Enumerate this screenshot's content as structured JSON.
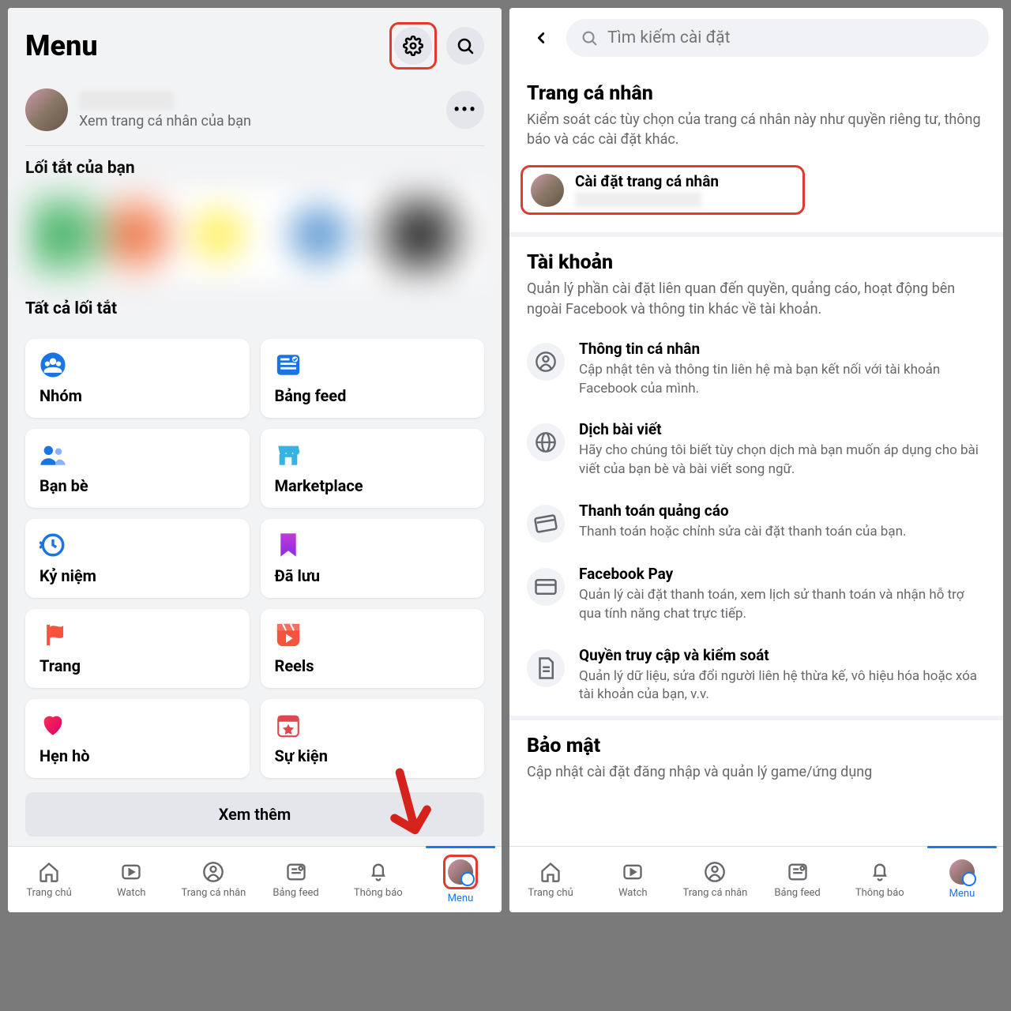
{
  "left": {
    "title": "Menu",
    "profile_sub": "Xem trang cá nhân của bạn",
    "shortcuts_label": "Lối tắt của bạn",
    "all_shortcuts_label": "Tất cả lối tắt",
    "tiles": [
      {
        "label": "Nhóm"
      },
      {
        "label": "Bảng feed"
      },
      {
        "label": "Bạn bè"
      },
      {
        "label": "Marketplace"
      },
      {
        "label": "Kỷ niệm"
      },
      {
        "label": "Đã lưu"
      },
      {
        "label": "Trang"
      },
      {
        "label": "Reels"
      },
      {
        "label": "Hẹn hò"
      },
      {
        "label": "Sự kiện"
      }
    ],
    "see_more": "Xem thêm"
  },
  "right": {
    "search_placeholder": "Tìm kiếm cài đặt",
    "profile_section": {
      "title": "Trang cá nhân",
      "desc": "Kiểm soát các tùy chọn của trang cá nhân này như quyền riêng tư, thông báo và các cài đặt khác.",
      "item": "Cài đặt trang cá nhân"
    },
    "account_section": {
      "title": "Tài khoản",
      "desc": "Quản lý phần cài đặt liên quan đến quyền, quảng cáo, hoạt động bên ngoài Facebook và thông tin khác về tài khoản.",
      "items": [
        {
          "title": "Thông tin cá nhân",
          "desc": "Cập nhật tên và thông tin liên hệ mà bạn kết nối với tài khoản Facebook của mình."
        },
        {
          "title": "Dịch bài viết",
          "desc": "Hãy cho chúng tôi biết tùy chọn dịch mà bạn muốn áp dụng cho bài viết của bạn bè và bài viết song ngữ."
        },
        {
          "title": "Thanh toán quảng cáo",
          "desc": "Thanh toán hoặc chỉnh sửa cài đặt thanh toán của bạn."
        },
        {
          "title": "Facebook Pay",
          "desc": "Quản lý cài đặt thanh toán, xem lịch sử thanh toán và nhận hỗ trợ qua tính năng chat trực tiếp."
        },
        {
          "title": "Quyền truy cập và kiểm soát",
          "desc": "Quản lý dữ liệu, sửa đổi người liên hệ thừa kế, vô hiệu hóa hoặc xóa tài khoản của bạn, v.v."
        }
      ]
    },
    "security_section": {
      "title": "Bảo mật",
      "desc": "Cập nhật cài đặt đăng nhập và quản lý game/ứng dụng"
    }
  },
  "bottom_nav": [
    {
      "label": "Trang chủ"
    },
    {
      "label": "Watch"
    },
    {
      "label": "Trang cá nhân"
    },
    {
      "label": "Bảng feed"
    },
    {
      "label": "Thông báo"
    },
    {
      "label": "Menu"
    }
  ]
}
